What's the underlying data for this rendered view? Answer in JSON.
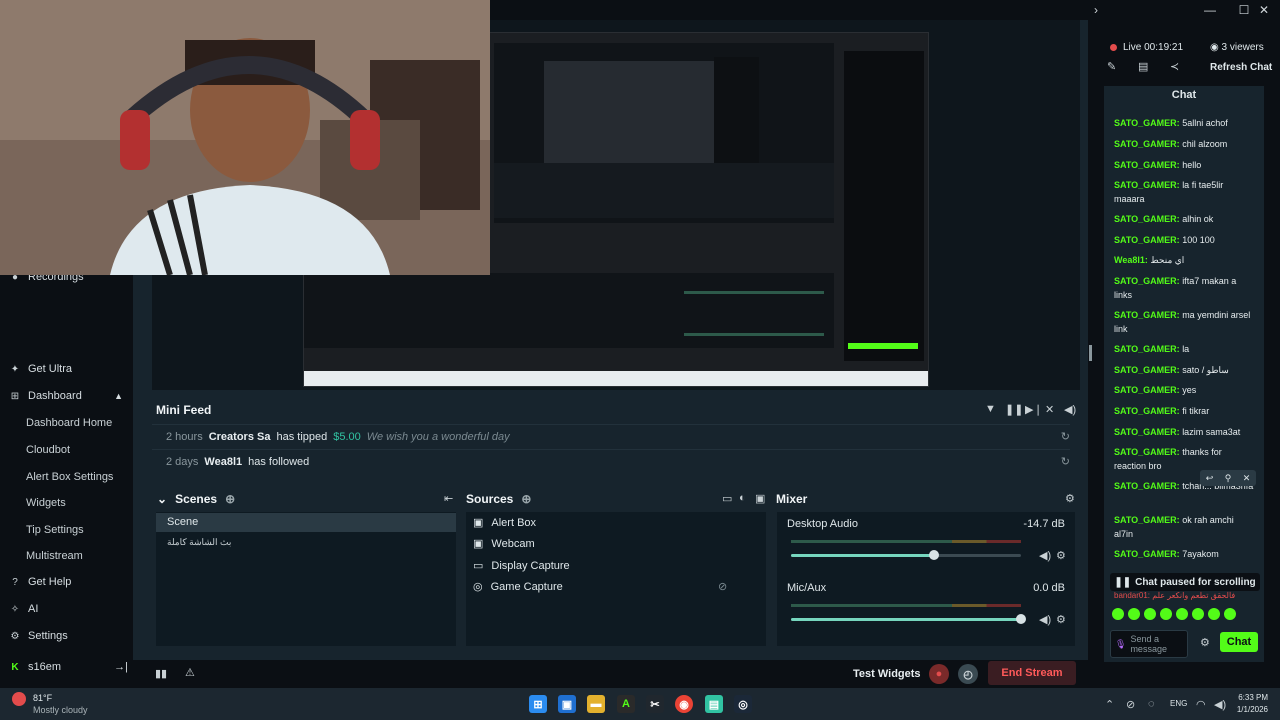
{
  "sidebar": {
    "recordings": "Recordings",
    "get_ultra": "Get Ultra",
    "dashboard": "Dashboard",
    "dashboard_items": [
      "Dashboard Home",
      "Cloudbot",
      "Alert Box Settings",
      "Widgets",
      "Tip Settings",
      "Multistream"
    ],
    "get_help": "Get Help",
    "ai": "AI",
    "settings": "Settings",
    "user": "s16em"
  },
  "minifeed": {
    "title": "Mini Feed",
    "rows": [
      {
        "time": "2 hours",
        "name": "Creators Sa",
        "action": "has tipped",
        "amount": "$5.00",
        "message": "We wish you a wonderful day"
      },
      {
        "time": "2 days",
        "name": "Wea8l1",
        "action": "has followed",
        "amount": "",
        "message": ""
      }
    ]
  },
  "scenes": {
    "title": "Scenes",
    "items": [
      "Scene",
      "بث الشاشة كاملة"
    ]
  },
  "sources": {
    "title": "Sources",
    "items": [
      "Alert Box",
      "Webcam",
      "Display Capture",
      "Game Capture"
    ]
  },
  "mixer": {
    "title": "Mixer",
    "channels": [
      {
        "name": "Desktop Audio",
        "db": "-14.7 dB",
        "level": 0.62
      },
      {
        "name": "Mic/Aux",
        "db": "0.0 dB",
        "level": 1.0
      }
    ]
  },
  "footer": {
    "test_widgets": "Test Widgets",
    "end_stream": "End Stream"
  },
  "status": {
    "live": "Live 00:19:21",
    "viewers": "3 viewers",
    "refresh": "Refresh Chat"
  },
  "chat": {
    "title": "Chat",
    "messages": [
      {
        "user": "SATO_GAMER:",
        "text": "5allni achof"
      },
      {
        "user": "SATO_GAMER:",
        "text": "chil alzoom"
      },
      {
        "user": "SATO_GAMER:",
        "text": "hello"
      },
      {
        "user": "SATO_GAMER:",
        "text": "la fi tae5lir maaara"
      },
      {
        "user": "SATO_GAMER:",
        "text": "alhin ok"
      },
      {
        "user": "SATO_GAMER:",
        "text": "100 100"
      },
      {
        "user": "Wea8l1:",
        "text": "اي منحط"
      },
      {
        "user": "SATO_GAMER:",
        "text": "ifta7 makan a links"
      },
      {
        "user": "SATO_GAMER:",
        "text": "ma yemdini arsel link"
      },
      {
        "user": "SATO_GAMER:",
        "text": "la"
      },
      {
        "user": "SATO_GAMER:",
        "text": "sato / ساطو"
      },
      {
        "user": "SATO_GAMER:",
        "text": "yes"
      },
      {
        "user": "SATO_GAMER:",
        "text": "fi tikrar"
      },
      {
        "user": "SATO_GAMER:",
        "text": "lazim sama3at"
      },
      {
        "user": "SATO_GAMER:",
        "text": "thanks for reaction bro"
      },
      {
        "user": "SATO_GAMER:",
        "text": "tchan... bilma3rifa"
      },
      {
        "user": "SATO_GAMER:",
        "text": "ok rah amchi al7in"
      },
      {
        "user": "SATO_GAMER:",
        "text": "7ayakom"
      }
    ],
    "paused": "Chat paused for scrolling",
    "partial": "bandar01: فالحقق تطعم وانكعر علم",
    "placeholder": "Send a message",
    "send": "Chat"
  },
  "taskbar": {
    "weather_temp": "81°F",
    "weather_desc": "Mostly cloudy",
    "lang": "ENG",
    "time": "6:33 PM",
    "date": "1/1/2026"
  },
  "colors": {
    "accent": "#53fc18",
    "live": "#e34c4c",
    "end": "#e34c4c"
  }
}
